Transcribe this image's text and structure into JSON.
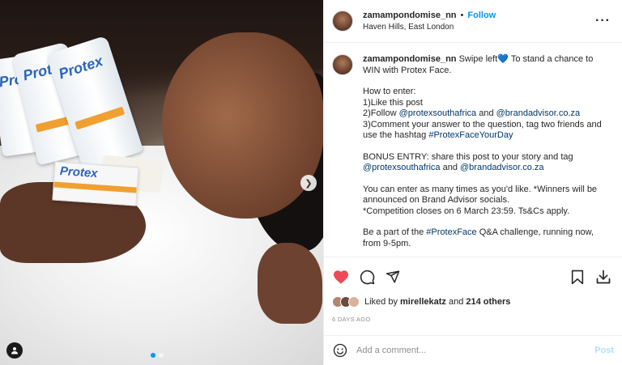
{
  "header": {
    "username": "zamampondomise_nn",
    "separator": "•",
    "follow_label": "Follow",
    "location": "Haven Hills, East London",
    "more_icon": "more-options-icon"
  },
  "caption": {
    "username": "zamampondomise_nn",
    "line1": " Swipe left💙 To stand a chance to WIN with Protex Face.",
    "how_to_enter": "How to enter:",
    "step1": "1)Like this post",
    "step2_prefix": "2)Follow ",
    "step2_handle1": "@protexsouthafrica",
    "step2_and": " and ",
    "step2_handle2": "@brandadvisor.co.za",
    "step3_text": "3)Comment your answer to the question, tag two friends and use the hashtag ",
    "step3_hashtag": "#ProtexFaceYourDay",
    "bonus_text": "BONUS ENTRY: share this post to your story and tag ",
    "bonus_handle1": "@protexsouthafrica",
    "bonus_and": " and ",
    "bonus_handle2": "@brandadvisor.co.za",
    "enter_many": "You can enter as many times as you'd like. *Winners will be announced on Brand Advisor socials.",
    "closes": "*Competition closes on 6 March 23:59. Ts&Cs apply.",
    "part_prefix": "Be a part of the ",
    "part_hashtag": "#ProtexFace",
    "part_suffix": " Q&A challenge, running now, from 9-5pm."
  },
  "media": {
    "product_brand": "Protex",
    "slide_count": 2,
    "active_slide": 1
  },
  "actions": {
    "liked_by_prefix": "Liked by ",
    "liked_by_user": "mirellekatz",
    "liked_by_and": " and ",
    "liked_by_others": "214 others",
    "timestamp": "6 DAYS AGO",
    "like_color": "#ed4956"
  },
  "comment_box": {
    "placeholder": "Add a comment...",
    "post_label": "Post"
  }
}
